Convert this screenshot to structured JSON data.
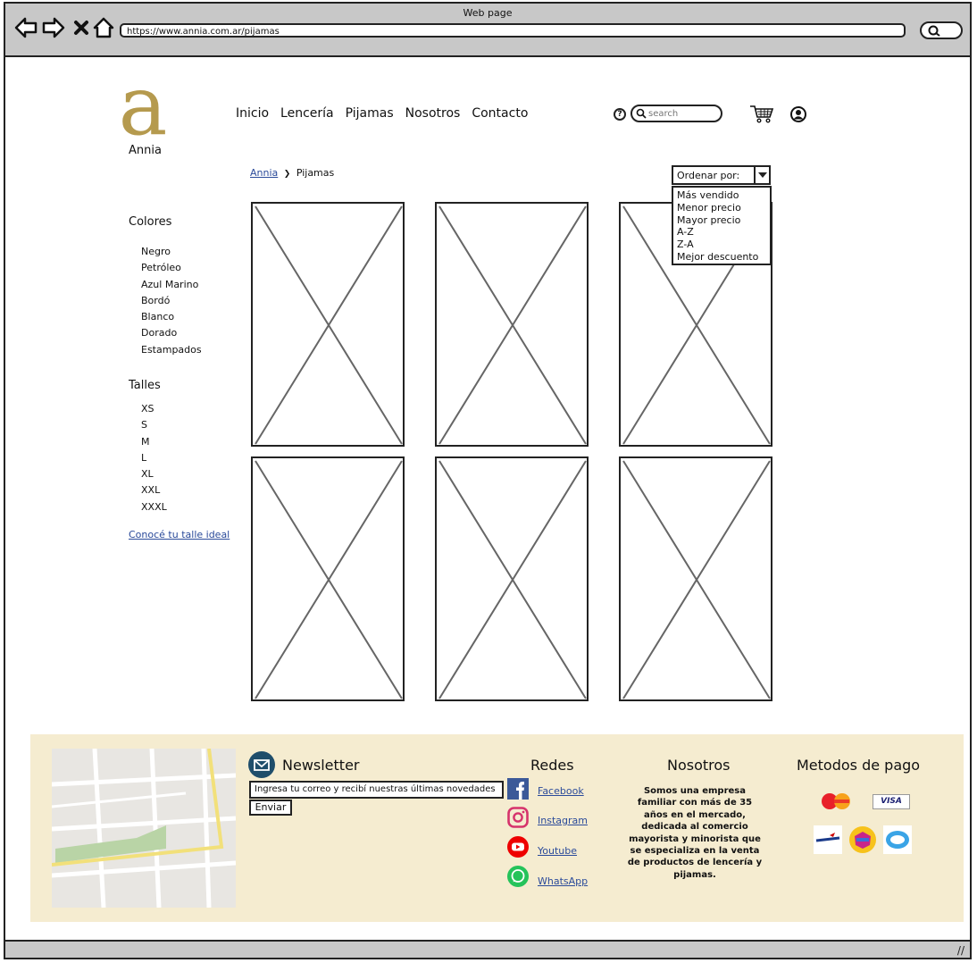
{
  "window": {
    "title": "Web page",
    "url": "https://www.annia.com.ar/pijamas"
  },
  "brand": {
    "name": "Annia",
    "logo_letter": "a",
    "color": "#b59a4e"
  },
  "nav": {
    "items": [
      "Inicio",
      "Lencería",
      "Pijamas",
      "Nosotros",
      "Contacto"
    ]
  },
  "search": {
    "placeholder": "search"
  },
  "breadcrumb": {
    "home": "Annia",
    "current": "Pijamas"
  },
  "sort": {
    "label": "Ordenar por:",
    "options": [
      "Más vendido",
      "Menor precio",
      "Mayor precio",
      "A-Z",
      "Z-A",
      "Mejor descuento"
    ]
  },
  "filters": {
    "colors_title": "Colores",
    "colors": [
      "Negro",
      "Petróleo",
      "Azul Marino",
      "Bordó",
      "Blanco",
      "Dorado",
      "Estampados"
    ],
    "sizes_title": "Talles",
    "sizes": [
      "XS",
      "S",
      "M",
      "L",
      "XL",
      "XXL",
      "XXXL"
    ],
    "size_guide_link": "Conocé tu talle ideal"
  },
  "products": {
    "count": 6
  },
  "footer": {
    "background": "#f5ecd0",
    "newsletter": {
      "title": "Newsletter",
      "input_placeholder": "Ingresa tu correo y recibí nuestras últimas novedades",
      "button": "Enviar"
    },
    "social": {
      "title": "Redes",
      "links": [
        "Facebook",
        "Instagram",
        "Youtube",
        "WhatsApp"
      ]
    },
    "about": {
      "title": "Nosotros",
      "text": "Somos una empresa familiar con más de 35 años en el mercado, dedicada al comercio mayorista y minorista que se especializa en la venta de productos de lencería y pijamas."
    },
    "payment": {
      "title": "Metodos de pago",
      "visa_text": "VISA"
    }
  }
}
